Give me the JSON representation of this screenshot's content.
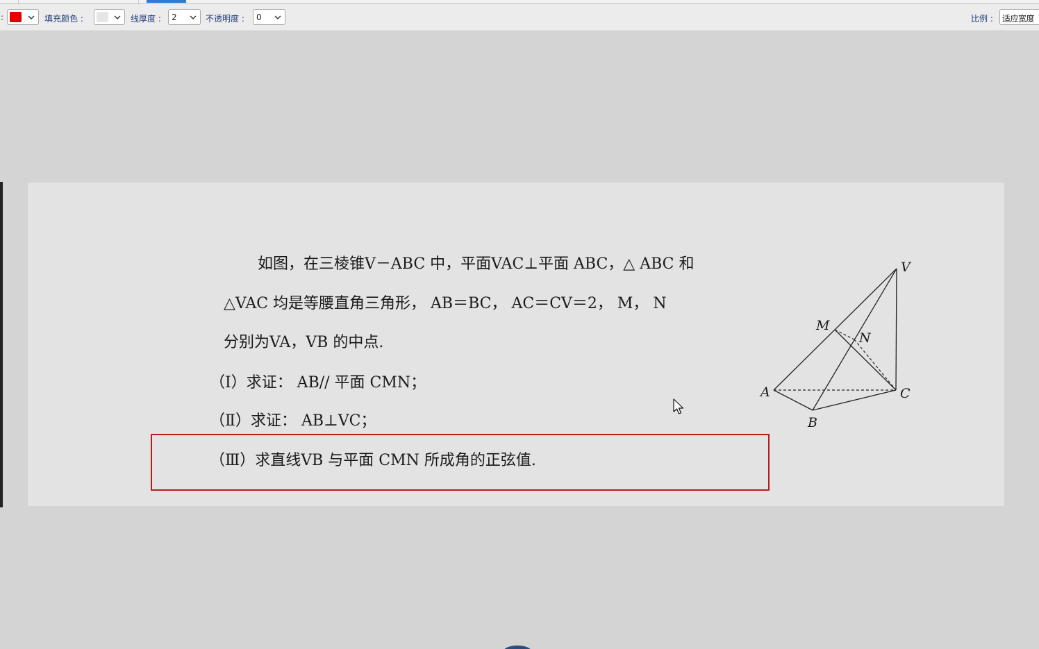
{
  "toolbar": {
    "colon_fragment": ":",
    "stroke_color": "#e00000",
    "fill_label": "填充颜色 :",
    "fill_color": "#e6e6e6",
    "thickness_label": "线厚度 :",
    "thickness_value": "2",
    "opacity_label": "不透明度 :",
    "opacity_value": "0",
    "scale_label": "比例 :",
    "scale_value": "适应宽度"
  },
  "problem": {
    "line1": "如图，在三棱锥V－ABC 中，平面VAC⊥平面 ABC，△ ABC 和",
    "line2": "△VAC 均是等腰直角三角形， AB＝BC， AC＝CV＝2， M， N",
    "line3": "分别为VA，VB 的中点.",
    "part1": "（Ⅰ）求证： AB// 平面 CMN；",
    "part2": "（Ⅱ）求证： AB⊥VC；",
    "part3": "（Ⅲ）求直线VB 与平面 CMN 所成角的正弦值."
  },
  "figure": {
    "label_V": "V",
    "label_M": "M",
    "label_N": "N",
    "label_A": "A",
    "label_B": "B",
    "label_C": "C"
  },
  "colors": {
    "highlight_border": "#b3201c",
    "accent_tab": "#2b7bd6"
  }
}
